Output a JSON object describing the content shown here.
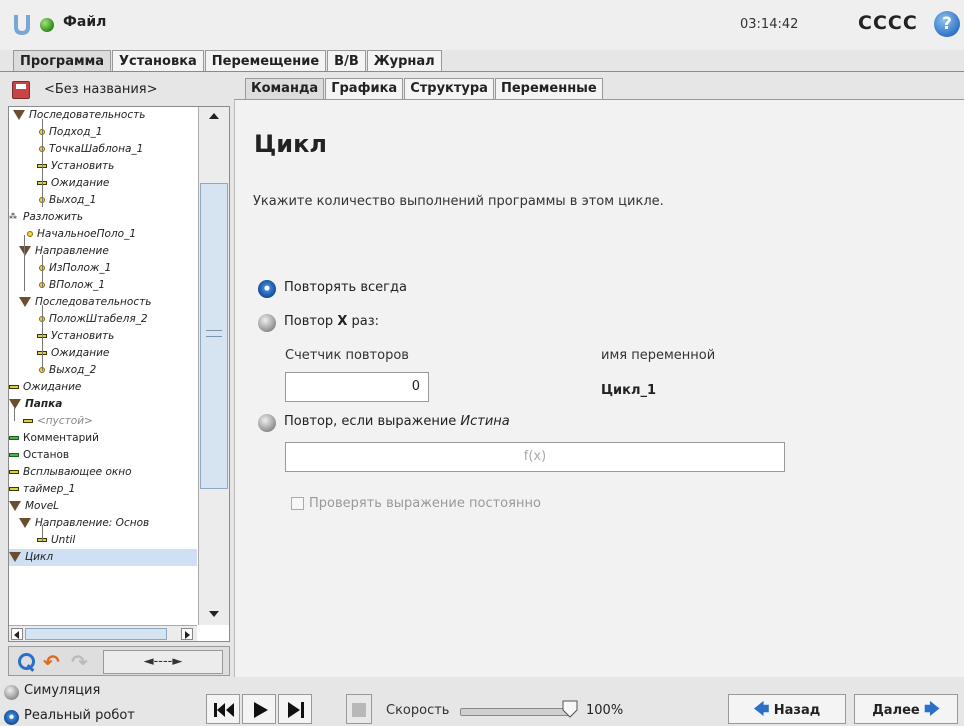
{
  "topbar": {
    "file_menu": "Файл",
    "time": "03:14:42",
    "robot_name": "CCCC",
    "help": "?"
  },
  "main_tabs": [
    "Программа",
    "Установка",
    "Перемещение",
    "В/В",
    "Журнал"
  ],
  "left": {
    "program_name": "<Без названия>",
    "tree": [
      {
        "label": "Последовательность",
        "icon": "triangle"
      },
      {
        "label": "Подход_1",
        "icon": "point"
      },
      {
        "label": "ТочкаШаблона_1",
        "icon": "point"
      },
      {
        "label": "Установить",
        "icon": "bar"
      },
      {
        "label": "Ожидание",
        "icon": "bar"
      },
      {
        "label": "Выход_1",
        "icon": "point"
      },
      {
        "label": "Разложить",
        "icon": "pallet"
      },
      {
        "label": "НачальноеПоло_1",
        "icon": "point"
      },
      {
        "label": "Направление",
        "icon": "triangle"
      },
      {
        "label": "ИзПолож_1",
        "icon": "point"
      },
      {
        "label": "ВПолож_1",
        "icon": "point"
      },
      {
        "label": "Последовательность",
        "icon": "triangle"
      },
      {
        "label": "ПоложШтабеля_2",
        "icon": "point"
      },
      {
        "label": "Установить",
        "icon": "bar"
      },
      {
        "label": "Ожидание",
        "icon": "bar"
      },
      {
        "label": "Выход_2",
        "icon": "point"
      },
      {
        "label": "Ожидание",
        "icon": "bar"
      },
      {
        "label": "Папка",
        "icon": "triangle"
      },
      {
        "label": "<пустой>",
        "icon": "bar"
      },
      {
        "label": "Комментарий",
        "icon": "bar-green"
      },
      {
        "label": "Останов",
        "icon": "bar-green"
      },
      {
        "label": "Всплывающее окно",
        "icon": "bar"
      },
      {
        "label": "таймер_1",
        "icon": "bar"
      },
      {
        "label": "MoveL",
        "icon": "triangle"
      },
      {
        "label": "Направление: Основ",
        "icon": "triangle"
      },
      {
        "label": "Until",
        "icon": "bar"
      },
      {
        "label": "Цикл",
        "icon": "triangle"
      }
    ],
    "move_button": "◄----►"
  },
  "sub_tabs": [
    "Команда",
    "Графика",
    "Структура",
    "Переменные"
  ],
  "content": {
    "title": "Цикл",
    "description": "Укажите количество выполнений программы в этом цикле.",
    "option_always": "Повторять всегда",
    "option_times_prefix": "Повтор ",
    "option_times_bold": "X",
    "option_times_suffix": " раз:",
    "counter_caption": "Счетчик повторов",
    "counter_value": "0",
    "varname_caption": "имя переменной",
    "varname_value": "Цикл_1",
    "option_expr_prefix": "Повтор, если выражение ",
    "option_expr_italic": "Истина",
    "expr_placeholder": "f(x)",
    "check_label": "Проверять выражение постоянно"
  },
  "footer": {
    "simulation": "Симуляция",
    "real_robot": "Реальный робот",
    "speed_label": "Скорость",
    "speed_value": "100%",
    "speed_fraction": 1.0,
    "back": "Назад",
    "next": "Далее"
  },
  "colors": {
    "accent": "#2a70c8",
    "status_green": "#2f8a1c"
  }
}
